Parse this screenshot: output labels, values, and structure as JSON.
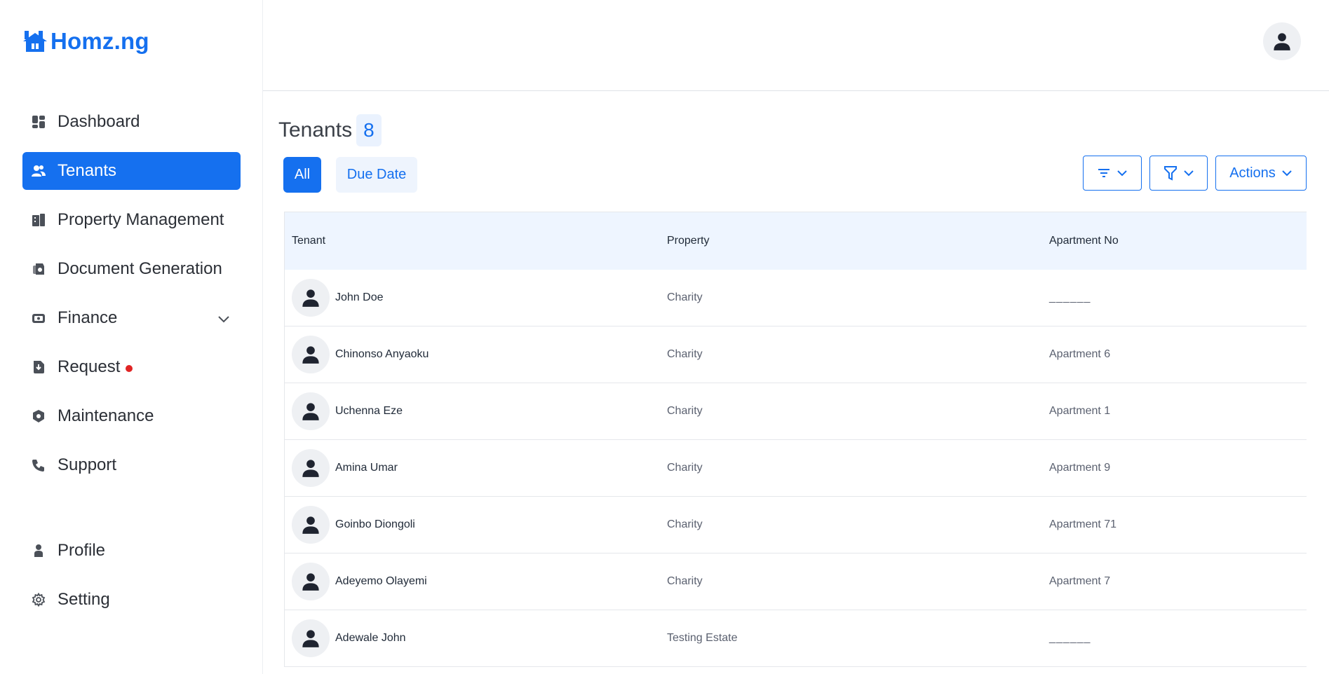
{
  "brand": {
    "name": "Homz.ng",
    "color": "#1570ef"
  },
  "sidebar": {
    "items": [
      {
        "label": "Dashboard",
        "icon": "dashboard-icon"
      },
      {
        "label": "Tenants",
        "icon": "users-icon",
        "active": true
      },
      {
        "label": "Property Management",
        "icon": "building-icon"
      },
      {
        "label": "Document Generation",
        "icon": "document-icon"
      },
      {
        "label": "Finance",
        "icon": "wallet-icon",
        "expandable": true
      },
      {
        "label": "Request",
        "icon": "request-icon",
        "badge_dot": true
      },
      {
        "label": "Maintenance",
        "icon": "shield-icon"
      },
      {
        "label": "Support",
        "icon": "phone-icon"
      },
      {
        "label": "Profile",
        "icon": "person-icon"
      },
      {
        "label": "Setting",
        "icon": "gear-icon"
      }
    ]
  },
  "header": {
    "avatar_icon": "user-avatar-icon"
  },
  "main": {
    "title": "Tenants",
    "count": "8",
    "tabs": [
      {
        "label": "All",
        "active": true
      },
      {
        "label": "Due Date",
        "active": false
      }
    ],
    "toolbar": {
      "sort_icon": "sort-lines-icon",
      "filter_icon": "funnel-icon",
      "actions_label": "Actions"
    },
    "table": {
      "columns": [
        "Tenant",
        "Property",
        "Apartment No"
      ],
      "rows": [
        {
          "tenant": "John Doe",
          "property": "Charity",
          "apartment": "______"
        },
        {
          "tenant": "Chinonso Anyaoku",
          "property": "Charity",
          "apartment": "Apartment 6"
        },
        {
          "tenant": "Uchenna Eze",
          "property": "Charity",
          "apartment": "Apartment 1"
        },
        {
          "tenant": "Amina Umar",
          "property": "Charity",
          "apartment": "Apartment 9"
        },
        {
          "tenant": "Goinbo Diongoli",
          "property": "Charity",
          "apartment": "Apartment 71"
        },
        {
          "tenant": "Adeyemo Olayemi",
          "property": "Charity",
          "apartment": "Apartment 7"
        },
        {
          "tenant": "Adewale John",
          "property": "Testing Estate",
          "apartment": "______"
        }
      ]
    }
  },
  "colors": {
    "accent": "#1570ef",
    "active_nav_bg": "#1570ef",
    "table_header_bg": "#eef5ff",
    "notification_dot": "#e02424"
  }
}
